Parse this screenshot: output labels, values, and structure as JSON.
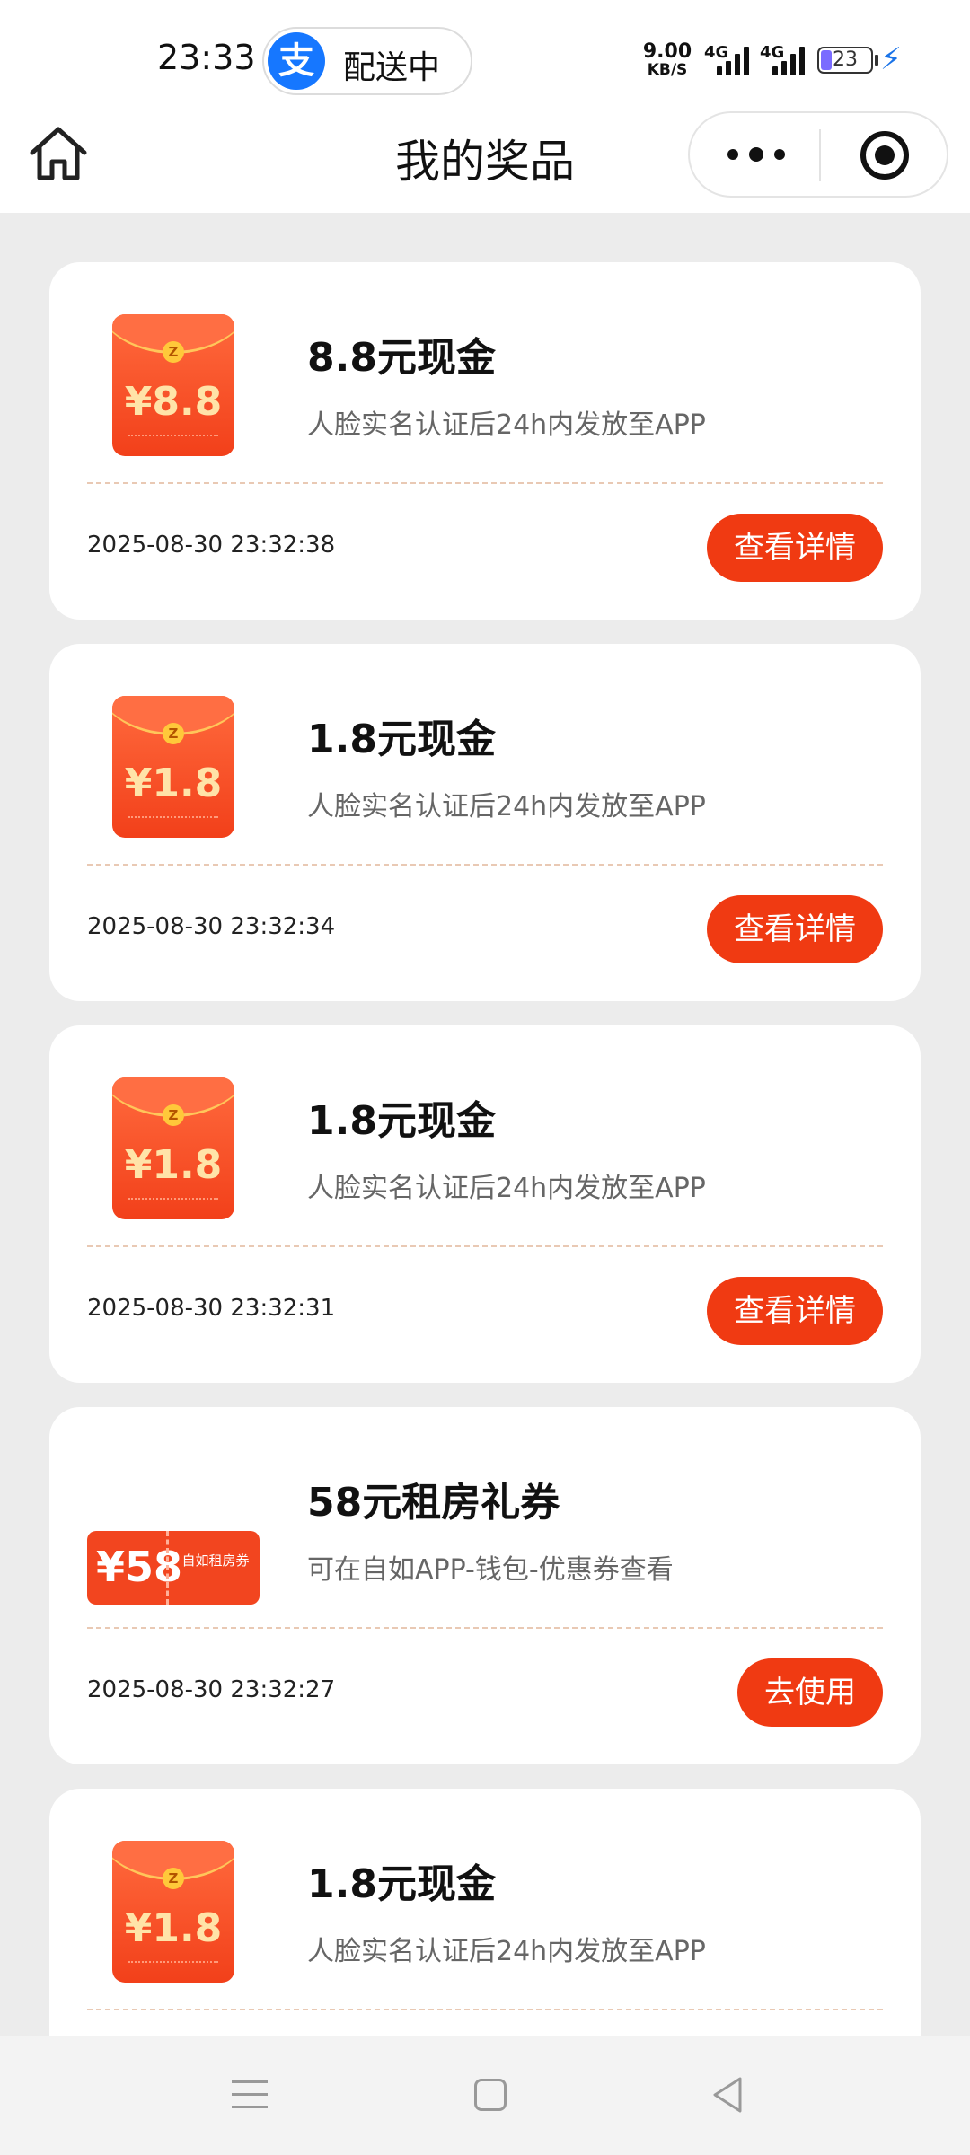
{
  "status_bar": {
    "time": "23:33",
    "capsule_text": "配送中",
    "app_logo_char": "支",
    "net_speed_value": "9.00",
    "net_speed_unit": "KB/S",
    "sim1": "4G",
    "sim2": "4G",
    "battery": "23"
  },
  "nav": {
    "title": "我的奖品"
  },
  "colors": {
    "accent": "#f03a12",
    "brand_blue": "#1677ff"
  },
  "prizes": [
    {
      "thumb": "red-packet",
      "amount_label": "¥8.8",
      "title": "8.8元现金",
      "desc": "人脸实名认证后24h内发放至APP",
      "time": "2025-08-30 23:32:38",
      "button": "查看详情"
    },
    {
      "thumb": "red-packet",
      "amount_label": "¥1.8",
      "title": "1.8元现金",
      "desc": "人脸实名认证后24h内发放至APP",
      "time": "2025-08-30 23:32:34",
      "button": "查看详情"
    },
    {
      "thumb": "red-packet",
      "amount_label": "¥1.8",
      "title": "1.8元现金",
      "desc": "人脸实名认证后24h内发放至APP",
      "time": "2025-08-30 23:32:31",
      "button": "查看详情"
    },
    {
      "thumb": "voucher",
      "amount_label": "¥58",
      "voucher_label": "自如租房券",
      "title": "58元租房礼券",
      "desc": "可在自如APP-钱包-优惠券查看",
      "time": "2025-08-30 23:32:27",
      "button": "去使用"
    },
    {
      "thumb": "red-packet",
      "amount_label": "¥1.8",
      "title": "1.8元现金",
      "desc": "人脸实名认证后24h内发放至APP",
      "time": "",
      "button": ""
    }
  ]
}
